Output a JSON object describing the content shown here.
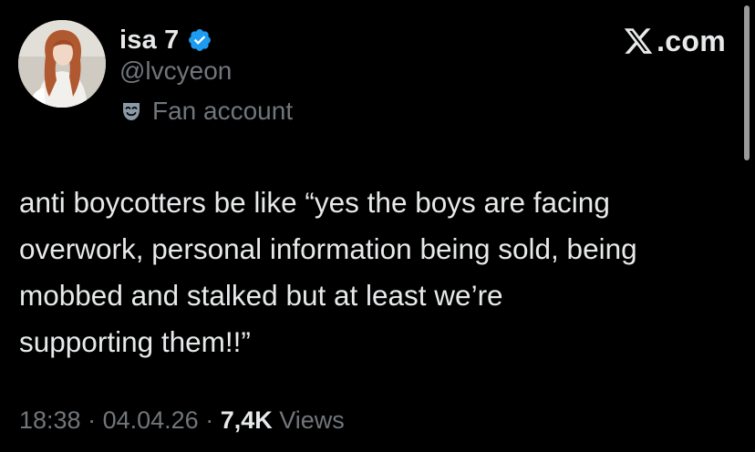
{
  "author": {
    "display_name": "isa 7",
    "handle": "@lvcyeon",
    "affiliation": "Fan account",
    "verified": true,
    "verified_color": "#1d9bf0"
  },
  "brand": {
    "label": ".com",
    "logo_icon": "x-logo-icon"
  },
  "tweet": {
    "text": "anti boycotters be like “yes the boys are facing\noverwork, personal information being sold, being\nmobbed and stalked but at least we’re\nsupporting them!!”"
  },
  "meta": {
    "time": "18:38",
    "separator": " · ",
    "date": "04.04.26",
    "views_count": "7,4K",
    "views_label": " Views"
  },
  "colors": {
    "background": "#000000",
    "primary_text": "#e7e9ea",
    "secondary_text": "#71767b"
  }
}
